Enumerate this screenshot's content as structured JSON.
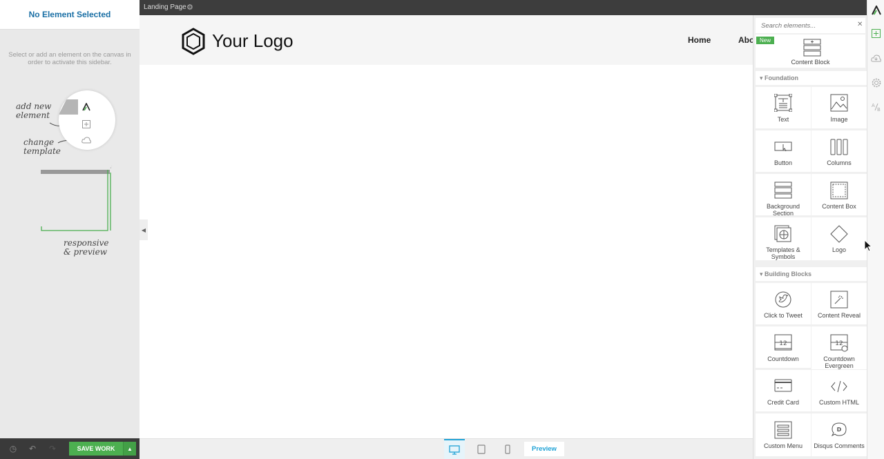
{
  "left_sidebar": {
    "title": "No Element Selected",
    "hint": "Select or add an element on the canvas in order to activate this sidebar.",
    "annotations": {
      "add_new": "add new element",
      "change_template": "change template",
      "responsive": "responsive & preview"
    },
    "save_label": "SAVE WORK"
  },
  "topbar": {
    "page_title": "Landing Page"
  },
  "canvas": {
    "logo_text": "Your Logo",
    "nav": {
      "home": "Home",
      "about": "About"
    }
  },
  "bottombar": {
    "preview_label": "Preview"
  },
  "panel": {
    "search_placeholder": "Search elements...",
    "new_badge": "New",
    "content_block": "Content Block",
    "foundation": {
      "heading": "Foundation",
      "items": [
        {
          "label": "Text",
          "icon": "text-icon"
        },
        {
          "label": "Image",
          "icon": "image-icon"
        },
        {
          "label": "Button",
          "icon": "button-icon"
        },
        {
          "label": "Columns",
          "icon": "columns-icon"
        },
        {
          "label": "Background Section",
          "icon": "background-section-icon"
        },
        {
          "label": "Content Box",
          "icon": "content-box-icon"
        },
        {
          "label": "Templates & Symbols",
          "icon": "templates-icon"
        },
        {
          "label": "Logo",
          "icon": "logo-icon"
        }
      ]
    },
    "building_blocks": {
      "heading": "Building Blocks",
      "items": [
        {
          "label": "Click to Tweet",
          "icon": "twitter-icon"
        },
        {
          "label": "Content Reveal",
          "icon": "content-reveal-icon"
        },
        {
          "label": "Countdown",
          "icon": "countdown-icon"
        },
        {
          "label": "Countdown Evergreen",
          "icon": "countdown-evergreen-icon"
        },
        {
          "label": "Credit Card",
          "icon": "credit-card-icon"
        },
        {
          "label": "Custom HTML",
          "icon": "code-icon"
        },
        {
          "label": "Custom Menu",
          "icon": "menu-icon"
        },
        {
          "label": "Disqus Comments",
          "icon": "disqus-icon"
        }
      ]
    }
  },
  "colors": {
    "accent": "#1fa2d6",
    "save_green": "#4caf50",
    "title_blue": "#1a6fa5"
  }
}
